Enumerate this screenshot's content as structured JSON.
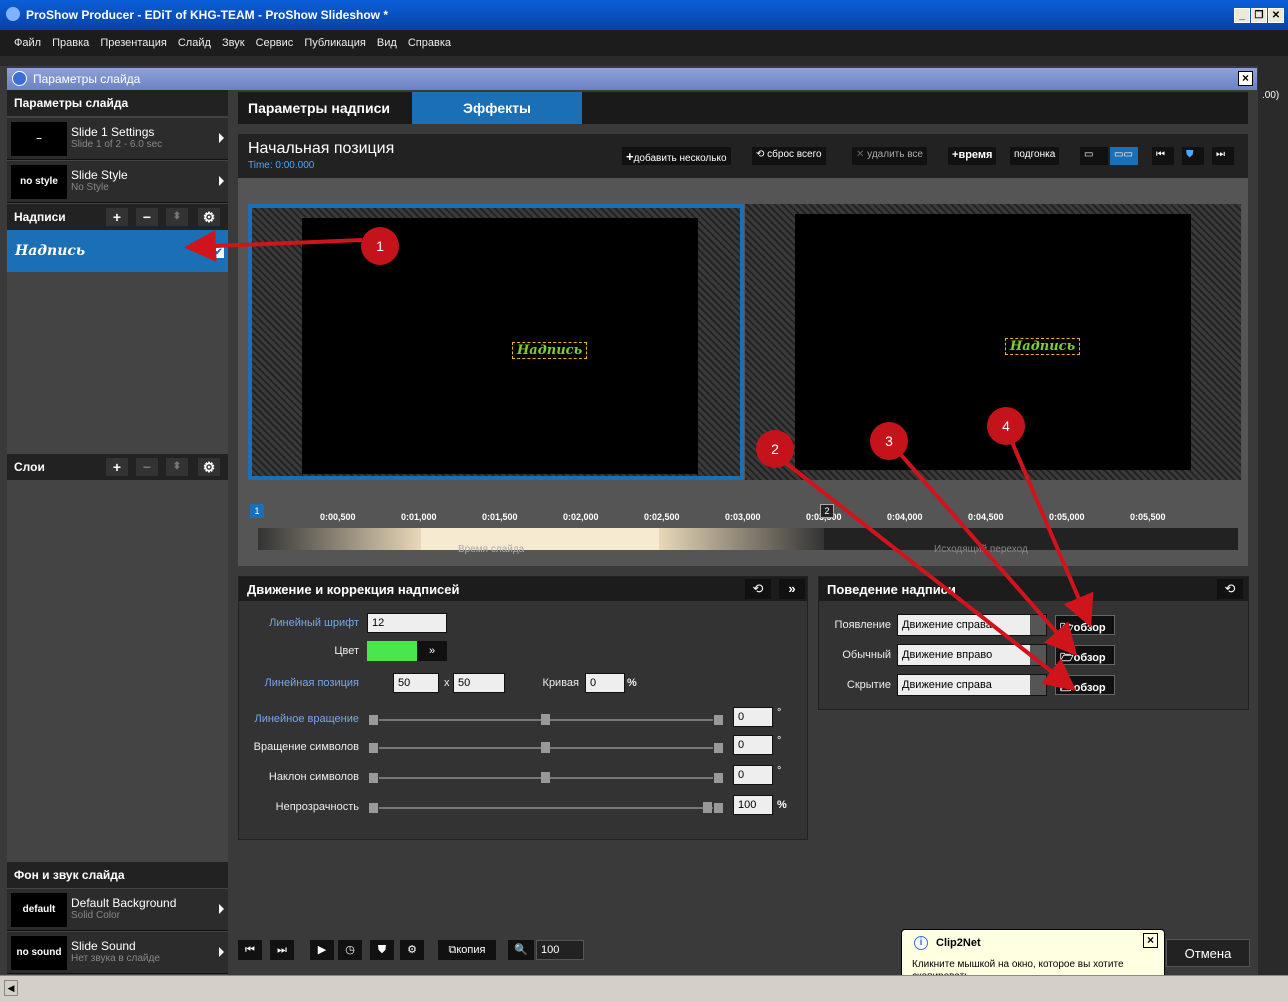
{
  "app": {
    "title": "ProShow Producer - EDiT of KHG-TEAM - ProShow Slideshow *"
  },
  "menu": [
    "Файл",
    "Правка",
    "Презентация",
    "Слайд",
    "Звук",
    "Сервис",
    "Публикация",
    "Вид",
    "Справка"
  ],
  "dialog": {
    "title": "Параметры слайда"
  },
  "sidebar": {
    "section_slide": "Параметры слайда",
    "slide_settings": {
      "thumb": "–",
      "title": "Slide 1 Settings",
      "sub": "Slide 1 of 2 - 6.0 sec"
    },
    "slide_style": {
      "thumb": "no style",
      "title": "Slide Style",
      "sub": "No Style"
    },
    "section_captions": "Надписи",
    "caption_item": "Надпись",
    "section_layers": "Слои",
    "section_bg": "Фон и звук слайда",
    "bg_card": {
      "thumb": "default",
      "title": "Default Background",
      "sub": "Solid Color"
    },
    "sound_card": {
      "thumb": "no sound",
      "title": "Slide Sound",
      "sub": "Нет звука в слайде"
    }
  },
  "tabs": {
    "caption_params": "Параметры надписи",
    "effects": "Эффекты"
  },
  "canvas": {
    "title": "Начальная позиция",
    "time": "Time: 0:00.000",
    "add_several": "добавить несколько",
    "reset_all": "сброс всего",
    "delete_all": "удалить все",
    "time_btn": "время",
    "fit_btn": "подгонка",
    "caption_text": "Надпись",
    "keyframe_2": "2",
    "keyframe_1": "1"
  },
  "timeline": {
    "ticks": [
      "0:00,500",
      "0:01,000",
      "0:01,500",
      "0:02,000",
      "0:02,500",
      "0:03,000",
      "0:03,500",
      "0:04,000",
      "0:04,500",
      "0:05,000",
      "0:05,500"
    ],
    "slide_time": "Время слайда",
    "out_transition": "Исходящий переход"
  },
  "motion_panel": {
    "title": "Движение и коррекция надписей",
    "font_label": "Линейный шрифт",
    "font_value": "12",
    "color_label": "Цвет",
    "pos_label": "Линейная позиция",
    "pos_x": "50",
    "pos_sep": "x",
    "pos_y": "50",
    "curve_label": "Кривая",
    "curve_value": "0",
    "pct": "%",
    "rot_label": "Линейное вращение",
    "rot_value": "0",
    "charrot_label": "Вращение символов",
    "charrot_value": "0",
    "tilt_label": "Наклон символов",
    "tilt_value": "0",
    "opacity_label": "Непрозрачность",
    "opacity_value": "100",
    "deg": "°"
  },
  "behavior_panel": {
    "title": "Поведение надписи",
    "appear_label": "Появление",
    "appear_value": "Движение справа",
    "normal_label": "Обычный",
    "normal_value": "Движение вправо",
    "hide_label": "Скрытие",
    "hide_value": "Движение справа",
    "browse": "обзор"
  },
  "bottom": {
    "copy": "копия",
    "zoom": "100"
  },
  "cancel": "Отмена",
  "tooltip": {
    "title": "Clip2Net",
    "text": "Кликните мышкой на окно, которое вы хотите скопировать"
  },
  "right_edge": {
    "value": ".00)"
  },
  "annotations": [
    "1",
    "2",
    "3",
    "4"
  ],
  "colors": {
    "accent": "#1a6fb5",
    "badge": "#c4131b",
    "caption_color": "#4be64b"
  }
}
